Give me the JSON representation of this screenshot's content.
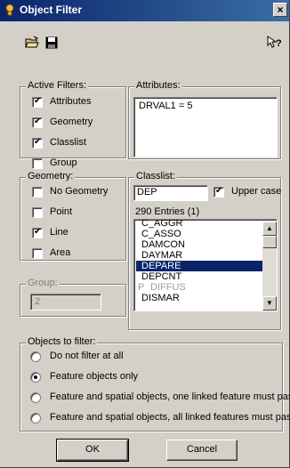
{
  "window": {
    "title": "Object Filter",
    "close_glyph": "×"
  },
  "toolbar": {
    "open_icon": "open-folder-icon",
    "save_icon": "save-disk-icon",
    "help_icon": "context-help-icon"
  },
  "active_filters": {
    "legend": "Active Filters:",
    "items": [
      {
        "label": "Attributes",
        "checked": true
      },
      {
        "label": "Geometry",
        "checked": true
      },
      {
        "label": "Classlist",
        "checked": true
      },
      {
        "label": "Group",
        "checked": false
      }
    ]
  },
  "attributes": {
    "legend": "Attributes:",
    "text": "DRVAL1 = 5"
  },
  "geometry": {
    "legend": "Geometry:",
    "items": [
      {
        "label": "No Geometry",
        "checked": false
      },
      {
        "label": "Point",
        "checked": false
      },
      {
        "label": "Line",
        "checked": true
      },
      {
        "label": "Area",
        "checked": false
      }
    ]
  },
  "classlist": {
    "legend": "Classlist:",
    "filter_value": "DEP",
    "uppercase_label": "Upper case",
    "uppercase_checked": true,
    "entries_text": "290 Entries (1)",
    "items": [
      {
        "label": "C_AGGR",
        "state": "normal"
      },
      {
        "label": "C_ASSO",
        "state": "normal"
      },
      {
        "label": "DAMCON",
        "state": "normal"
      },
      {
        "label": "DAYMAR",
        "state": "normal"
      },
      {
        "label": "DEPARE",
        "state": "selected"
      },
      {
        "label": "DEPCNT",
        "state": "normal"
      },
      {
        "label": "DIFFUS",
        "state": "disabled",
        "mark": "P"
      },
      {
        "label": "DISMAR",
        "state": "normal"
      }
    ]
  },
  "group": {
    "legend": "Group:",
    "value": "2"
  },
  "objects_to_filter": {
    "legend": "Objects to filter:",
    "options": [
      {
        "label": "Do not filter at all",
        "selected": false
      },
      {
        "label": "Feature objects only",
        "selected": true
      },
      {
        "label": "Feature and spatial objects, one linked feature must pass",
        "selected": false
      },
      {
        "label": "Feature and spatial objects, all linked features must pass",
        "selected": false
      }
    ]
  },
  "buttons": {
    "ok": "OK",
    "cancel": "Cancel"
  }
}
